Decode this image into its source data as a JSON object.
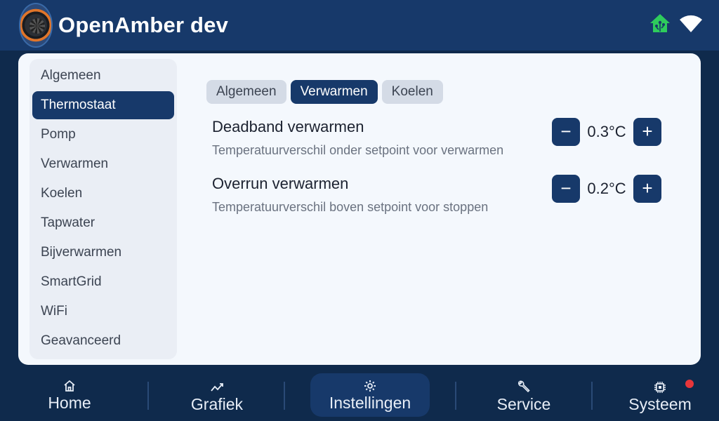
{
  "header": {
    "title": "OpenAmber dev",
    "icons": [
      "home-assistant-icon",
      "wifi-icon"
    ],
    "accent_color": "#17396a",
    "home_assistant_color": "#2ecc5c"
  },
  "sidebar": {
    "items": [
      {
        "label": "Algemeen"
      },
      {
        "label": "Thermostaat"
      },
      {
        "label": "Pomp"
      },
      {
        "label": "Verwarmen"
      },
      {
        "label": "Koelen"
      },
      {
        "label": "Tapwater"
      },
      {
        "label": "Bijverwarmen"
      },
      {
        "label": "SmartGrid"
      },
      {
        "label": "WiFi"
      },
      {
        "label": "Geavanceerd"
      }
    ],
    "selected": "Thermostaat"
  },
  "tabs": [
    {
      "label": "Algemeen"
    },
    {
      "label": "Verwarmen"
    },
    {
      "label": "Koelen"
    }
  ],
  "active_tab": "Verwarmen",
  "settings": [
    {
      "label": "Deadband verwarmen",
      "description": "Temperatuurverschil onder setpoint voor verwarmen",
      "value": "0.3°C",
      "minus": "−",
      "plus": "+"
    },
    {
      "label": "Overrun verwarmen",
      "description": "Temperatuurverschil boven setpoint voor stoppen",
      "value": "0.2°C",
      "minus": "−",
      "plus": "+"
    }
  ],
  "bottom_nav": {
    "items": [
      {
        "label": "Home",
        "icon": "home-icon"
      },
      {
        "label": "Grafiek",
        "icon": "chart-icon"
      },
      {
        "label": "Instellingen",
        "icon": "gear-icon"
      },
      {
        "label": "Service",
        "icon": "wrench-icon"
      },
      {
        "label": "Systeem",
        "icon": "chip-icon"
      }
    ],
    "active": "Instellingen",
    "alert_color": "#e8363a"
  }
}
